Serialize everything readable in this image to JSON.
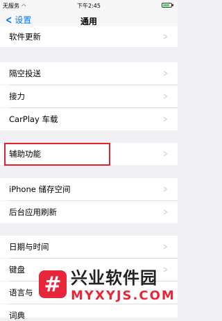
{
  "status": {
    "carrier": "无服务",
    "time": "下午2:45",
    "battery_level": 0.85
  },
  "nav": {
    "back_label": "设置",
    "title": "通用"
  },
  "rows": {
    "software_update": "软件更新",
    "airdrop": "隔空投送",
    "handoff": "接力",
    "carplay": "CarPlay 车载",
    "accessibility": "辅助功能",
    "storage": "iPhone 储存空间",
    "background_refresh": "后台应用刷新",
    "date_time": "日期与时间",
    "keyboard": "键盘",
    "language": "语言与",
    "partial": "词典"
  },
  "watermark": {
    "logo_char": "#",
    "title": "兴业软件园",
    "url": "MYXYJS.COM"
  },
  "colors": {
    "accent": "#007aff",
    "highlight": "#e0202c",
    "watermark": "#e8263a"
  }
}
